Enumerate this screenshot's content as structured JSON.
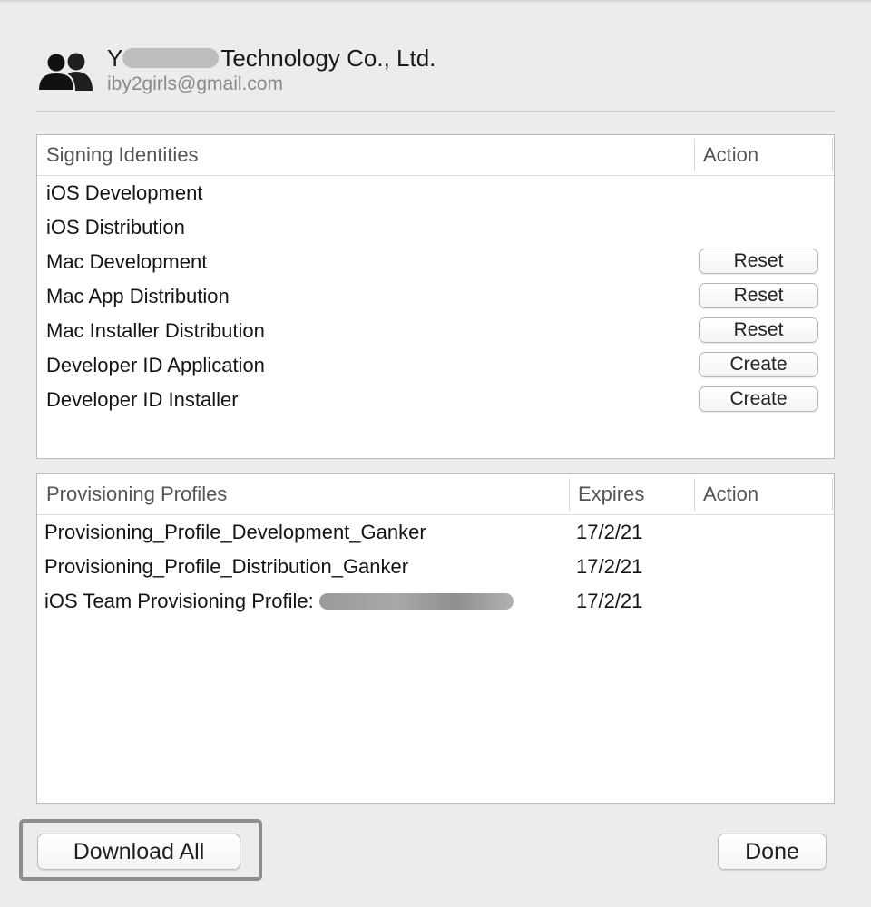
{
  "account": {
    "team_name_visible": "Y",
    "team_name_suffix": "Technology Co., Ltd.",
    "email": "iby2girls@gmail.com",
    "icon": "team-icon"
  },
  "signing_identities": {
    "header": "Signing Identities",
    "action_header": "Action",
    "rows": [
      {
        "label": "iOS Development",
        "action": null
      },
      {
        "label": "iOS Distribution",
        "action": null
      },
      {
        "label": "Mac Development",
        "action": "Reset"
      },
      {
        "label": "Mac App Distribution",
        "action": "Reset"
      },
      {
        "label": "Mac Installer Distribution",
        "action": "Reset"
      },
      {
        "label": "Developer ID Application",
        "action": "Create"
      },
      {
        "label": "Developer ID Installer",
        "action": "Create"
      }
    ]
  },
  "provisioning_profiles": {
    "header": "Provisioning Profiles",
    "expires_header": "Expires",
    "action_header": "Action",
    "rows": [
      {
        "name": "Provisioning_Profile_Development_Ganker",
        "expires": "17/2/21"
      },
      {
        "name": "Provisioning_Profile_Distribution_Ganker",
        "expires": "17/2/21"
      },
      {
        "name": "iOS Team Provisioning Profile:",
        "expires": "17/2/21"
      }
    ]
  },
  "footer": {
    "download_all_label": "Download All",
    "done_label": "Done"
  },
  "colors": {
    "window_background": "#ececec",
    "table_background": "#ffffff",
    "highlight_border": "#8e8e8e"
  }
}
